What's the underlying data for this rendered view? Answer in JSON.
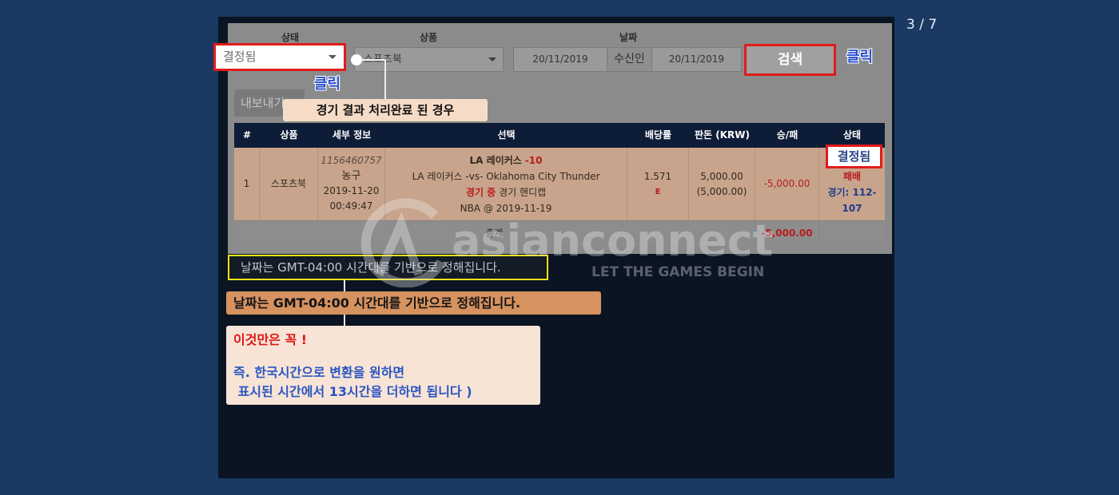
{
  "pager": "3 / 7",
  "filters": {
    "status": {
      "label": "상태",
      "value": "결정됨"
    },
    "product": {
      "label": "상품",
      "value": "스포츠북"
    },
    "date": {
      "label": "날짜",
      "from": "20/11/2019",
      "separator": "수신인",
      "to": "20/11/2019"
    },
    "search_button": "검색",
    "export_button": "내보내기"
  },
  "annotations": {
    "click_status": "클릭",
    "click_search": "클릭",
    "settled_note": "경기 결과 처리완료 된 경우",
    "timezone_notice": "날짜는 GMT-04:00 시간대를 기반으로 정해집니다.",
    "timezone_callout": "날짜는 GMT-04:00 시간대를 기반으로 정해집니다.",
    "tip": {
      "title": "이것만은 꼭 !",
      "line1": "즉. 한국시간으로 변환을 원하면",
      "line2": " 표시된 시간에서 13시간을 더하면 됩니다 )"
    }
  },
  "table": {
    "headers": [
      "#",
      "상품",
      "세부 정보",
      "선택",
      "배당률",
      "판돈 (KRW)",
      "승/패",
      "상태"
    ],
    "rows": [
      {
        "index": "1",
        "product": "스포츠북",
        "detail": {
          "bet_id": "1156460757",
          "sport": "농구",
          "date": "2019-11-20",
          "time": "00:49:47"
        },
        "selection": {
          "team": "LA 레이커스",
          "handicap": "-10",
          "match": "LA 레이커스 -vs- Oklahoma City Thunder",
          "live": "경기 중",
          "bet_type": "경기 핸디캡",
          "league": "NBA @ 2019-11-19"
        },
        "odds": {
          "value": "1.571",
          "format": "E"
        },
        "stake": {
          "value": "5,000.00",
          "sub": "(5,000.00)"
        },
        "win_loss": "-5,000.00",
        "status": {
          "value": "결정됨",
          "result": "패배",
          "score_line1": "경기: 112-",
          "score_line2": "107"
        }
      }
    ],
    "total": {
      "label": "총계",
      "win_loss": "-5,000.00"
    }
  },
  "watermark": {
    "brand": "asianconnect",
    "tagline": "LET THE GAMES BEGIN"
  },
  "icons": {
    "status_dropdown": "caret-down-icon",
    "product_dropdown": "caret-down-icon",
    "connector_marker": "dot-marker-icon"
  },
  "colors": {
    "page_background": "#1a3963",
    "panel_background": "#0a1422",
    "highlight_red": "#e11b1b",
    "click_blue": "#2a4fd0",
    "table_header": "#0e1d37",
    "row_background": "#c8a48c",
    "note_background": "#f6dcc6",
    "callout_background": "#d6925f",
    "tip_background": "#f7e4d7",
    "tip_title_red": "#e01414",
    "tip_text_blue": "#2b55c2",
    "notice_border": "#f2e21a",
    "loss_red": "#b81c1c",
    "score_blue": "#1f3e8c"
  }
}
